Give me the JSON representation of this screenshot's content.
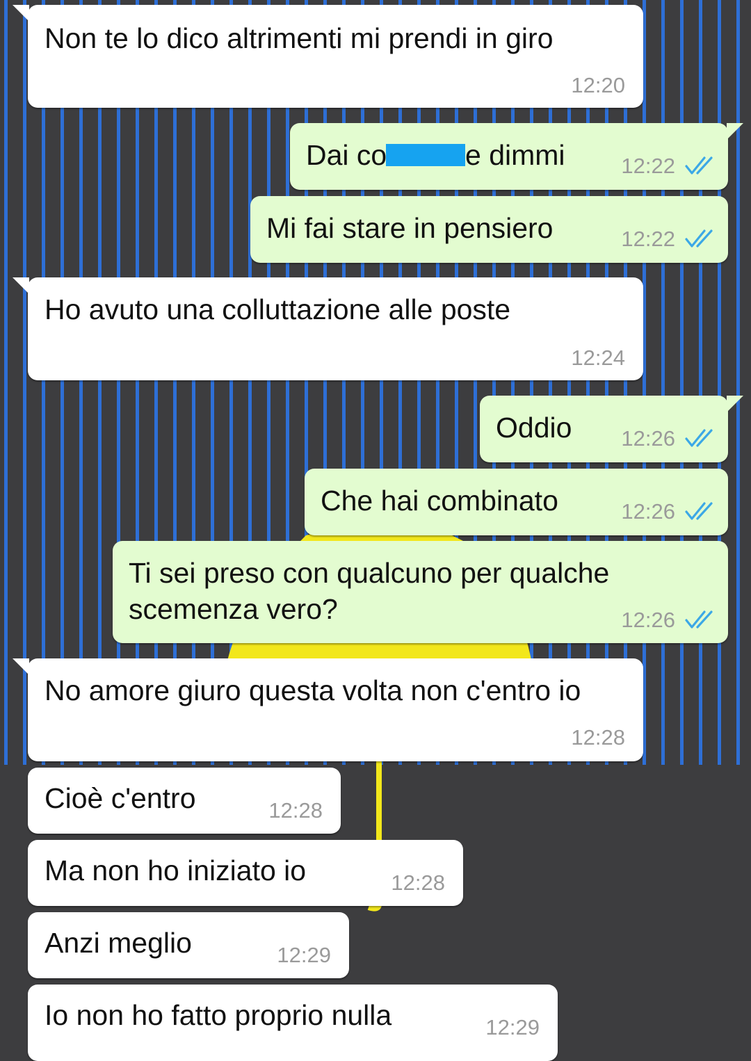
{
  "chat": {
    "messages": [
      {
        "dir": "in",
        "text": "Non te lo dico altrimenti mi prendi in giro",
        "time": "12:20"
      },
      {
        "dir": "out",
        "text": "Dai co",
        "text_after": "e dimmi",
        "time": "12:22",
        "status": "read-double-check"
      },
      {
        "dir": "out",
        "text": "Mi fai stare in pensiero",
        "time": "12:22",
        "status": "read-double-check"
      },
      {
        "dir": "in",
        "text": "Ho avuto una colluttazione alle poste",
        "time": "12:24"
      },
      {
        "dir": "out",
        "text": "Oddio",
        "time": "12:26",
        "status": "read-double-check"
      },
      {
        "dir": "out",
        "text": "Che hai combinato",
        "time": "12:26",
        "status": "read-double-check"
      },
      {
        "dir": "out",
        "text_line1": "Ti sei preso con qualcuno per qualche",
        "text_line2": "scemenza vero?",
        "time": "12:26",
        "status": "read-double-check"
      },
      {
        "dir": "in",
        "text": "No amore giuro questa volta non c'entro io",
        "time": "12:28"
      },
      {
        "dir": "in",
        "text": "Cioè c'entro",
        "time": "12:28"
      },
      {
        "dir": "in",
        "text": "Ma non ho iniziato io",
        "time": "12:28"
      },
      {
        "dir": "in",
        "text": "Anzi meglio",
        "time": "12:29"
      },
      {
        "dir": "in",
        "text": "Io non ho fatto proprio nulla",
        "time": "12:29"
      }
    ]
  },
  "colors": {
    "incoming_bubble": "#ffffff",
    "outgoing_bubble": "#e3fcd0",
    "read_ticks": "#3ca8e6",
    "timestamp": "#9a9a9a",
    "redaction": "#16a3f0",
    "wallpaper_bg": "#3d3d3f",
    "wallpaper_stripes": "#2e6fd6",
    "wallpaper_lamp": "#f2e71b"
  },
  "icons": {
    "read_status": "double-check-icon",
    "redaction": "redaction-mark"
  }
}
